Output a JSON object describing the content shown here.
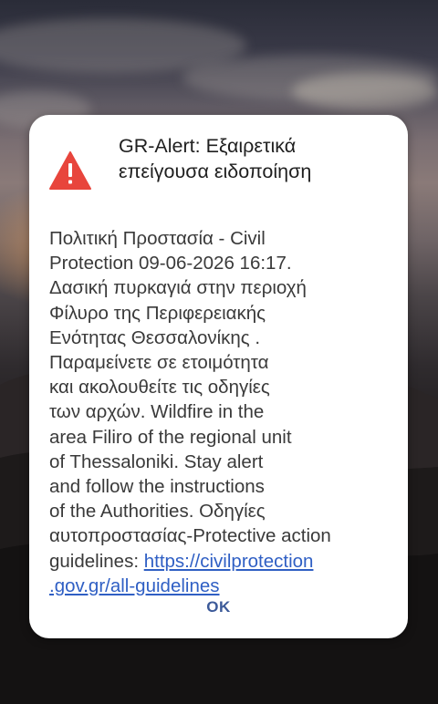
{
  "alert": {
    "title": "GR-Alert: Εξαιρετικά επείγουσα ειδοποίηση",
    "body_text": "Πολιτική Προστασία - Civil\nProtection 09-06-2026 16:17.\nΔασική πυρκαγιά στην περιοχή\nΦίλυρο της Περιφερειακής\nΕνότητας Θεσσαλονίκης .\nΠαραμείνετε σε ετοιμότητα\nκαι ακολουθείτε τις οδηγίες\nτων αρχών. Wildfire in the\narea Filiro of the regional unit\nof Thessaloniki. Stay alert\nand follow the instructions\nof the Authorities. Οδηγίες\nαυτοπροστασίας-Protective action\nguidelines: ",
    "link_text": "https://civilprotection\n.gov.gr/all-guidelines",
    "ok_label": "OK",
    "icon": "warning-icon",
    "icon_color": "#e8453c",
    "button_color": "#3c5a99",
    "link_color": "#2f5fc4"
  }
}
